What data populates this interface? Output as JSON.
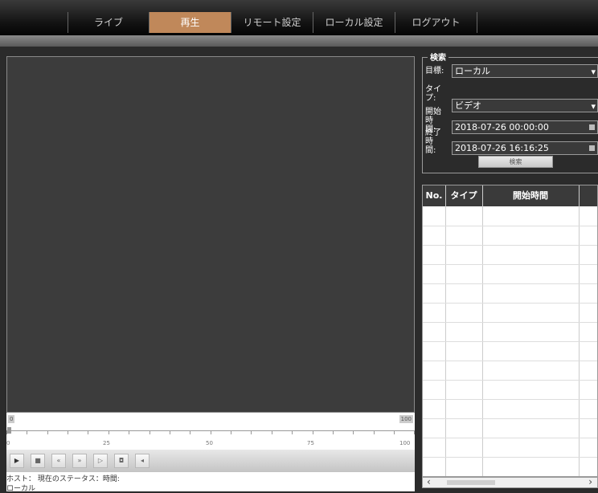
{
  "nav": {
    "tabs": [
      {
        "label": "ライブ"
      },
      {
        "label": "再生"
      },
      {
        "label": "リモート設定"
      },
      {
        "label": "ローカル設定"
      },
      {
        "label": "ログアウト"
      }
    ],
    "active_tab": "再生",
    "active_color": "#c0885a"
  },
  "timeline": {
    "start_badge": "0",
    "end_badge": "100",
    "tick_labels": [
      "0",
      "25",
      "50",
      "75",
      "100"
    ],
    "position": 0
  },
  "controls": {
    "buttons": [
      "play-icon",
      "stop-icon",
      "rewind-icon",
      "fast-forward-icon",
      "frame-step-icon",
      "snapshot-icon",
      "volume-icon"
    ]
  },
  "status": {
    "line1": "ホスト：   現在のステータス：時間:",
    "line2": "ローカル"
  },
  "search": {
    "legend": "検索",
    "target_label": "目標:",
    "target_value": "ローカル",
    "type_label": "タイプ:",
    "type_value": "ビデオ",
    "start_label": "開始時間:",
    "start_value": "2018-07-26 00:00:00",
    "end_label": "終了時間:",
    "end_value": "2018-07-26 16:16:25",
    "button_label": "検索"
  },
  "results": {
    "columns": [
      "No.",
      "タイプ",
      "開始時間"
    ],
    "rows": []
  }
}
